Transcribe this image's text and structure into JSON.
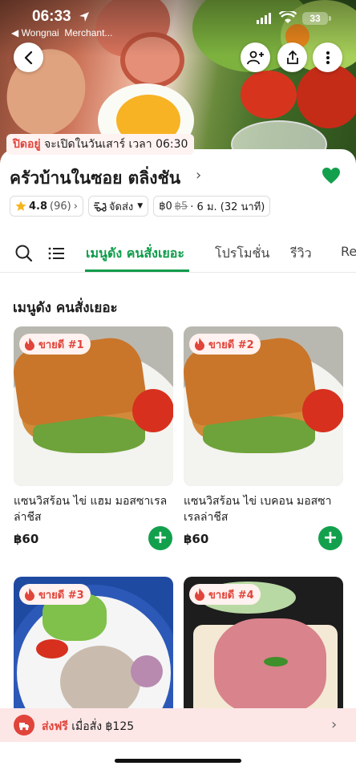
{
  "status_bar": {
    "time": "06:33",
    "back_app": "◀ Wongnai",
    "back_app2": "Merchant...",
    "battery": "33"
  },
  "hero": {
    "closed_status": "ปิดอยู่",
    "reopen_text": "จะเปิดในวันเสาร์ เวลา 06:30"
  },
  "restaurant": {
    "name": "ครัวบ้านในซอย ตลิ่งชัน",
    "rating": "4.8",
    "review_count": "(96)",
    "delivery_mode": "จัดส่ง",
    "delivery_fee": "฿0",
    "delivery_fee_original": "฿5",
    "distance_time": "· 6 ม. (32 นาที)"
  },
  "tabs": {
    "items": [
      "เมนูดัง คนสั่งเยอะ",
      "โปรโมชั่น",
      "รีวิว",
      "Re"
    ],
    "active_index": 0
  },
  "section": {
    "title": "เมนูดัง คนสั่งเยอะ"
  },
  "products": [
    {
      "rank": "ขายดี #1",
      "name": "แซนวิสร้อน ไข่ แฮม มอสซาเรลล่าชีส",
      "price": "฿60"
    },
    {
      "rank": "ขายดี #2",
      "name": "แซนวิสร้อน ไข่ เบคอน มอสซาเรลล่าชีส",
      "price": "฿60"
    },
    {
      "rank": "ขายดี #3",
      "name": "",
      "price": ""
    },
    {
      "rank": "ขายดี #4",
      "name": "",
      "price": ""
    }
  ],
  "promo_bar": {
    "label": "ส่งฟรี",
    "condition": "เมื่อสั่ง ฿125"
  },
  "colors": {
    "brand_green": "#0e9c4a",
    "accent_red": "#e0443a",
    "promo_bg": "#fde6e6"
  },
  "icons": [
    "back-arrow-icon",
    "add-friend-icon",
    "share-icon",
    "more-icon",
    "heart-icon",
    "star-icon",
    "delivery-icon",
    "search-icon",
    "list-icon",
    "fire-icon",
    "plus-icon",
    "chevron-right-icon"
  ]
}
